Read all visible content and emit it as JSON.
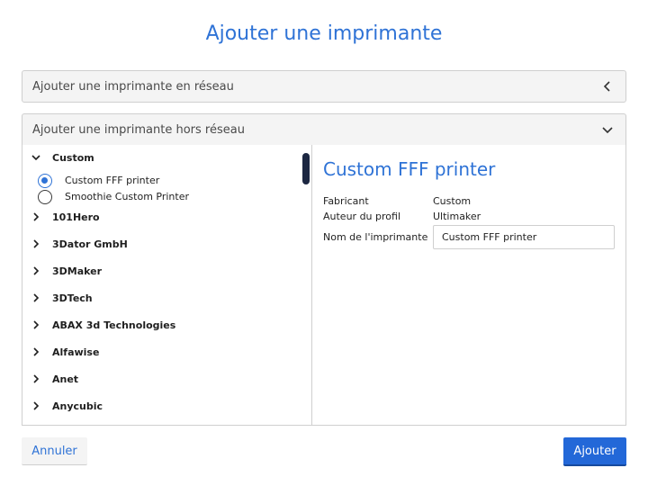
{
  "dialog": {
    "title": "Ajouter une imprimante",
    "network_section": "Ajouter une imprimante en réseau",
    "local_section": "Ajouter une imprimante hors réseau",
    "cancel_label": "Annuler",
    "add_label": "Ajouter"
  },
  "tree": {
    "expanded": {
      "name": "Custom",
      "printers": [
        {
          "label": "Custom FFF printer",
          "selected": true
        },
        {
          "label": "Smoothie Custom Printer",
          "selected": false
        }
      ]
    },
    "manufacturers": [
      "101Hero",
      "3Dator GmbH",
      "3DMaker",
      "3DTech",
      "ABAX 3d Technologies",
      "Alfawise",
      "Anet",
      "Anycubic"
    ]
  },
  "details": {
    "title": "Custom FFF printer",
    "manufacturer_label": "Fabricant",
    "manufacturer_value": "Custom",
    "author_label": "Auteur du profil",
    "author_value": "Ultimaker",
    "name_label": "Nom de l'imprimante",
    "name_value": "Custom FFF printer"
  },
  "colors": {
    "accent": "#2f73d6",
    "button": "#2368d8"
  },
  "icons": {
    "collapsed": "chevron-left-icon",
    "expanded": "chevron-down-icon",
    "tree_collapsed": "chevron-right-icon"
  }
}
